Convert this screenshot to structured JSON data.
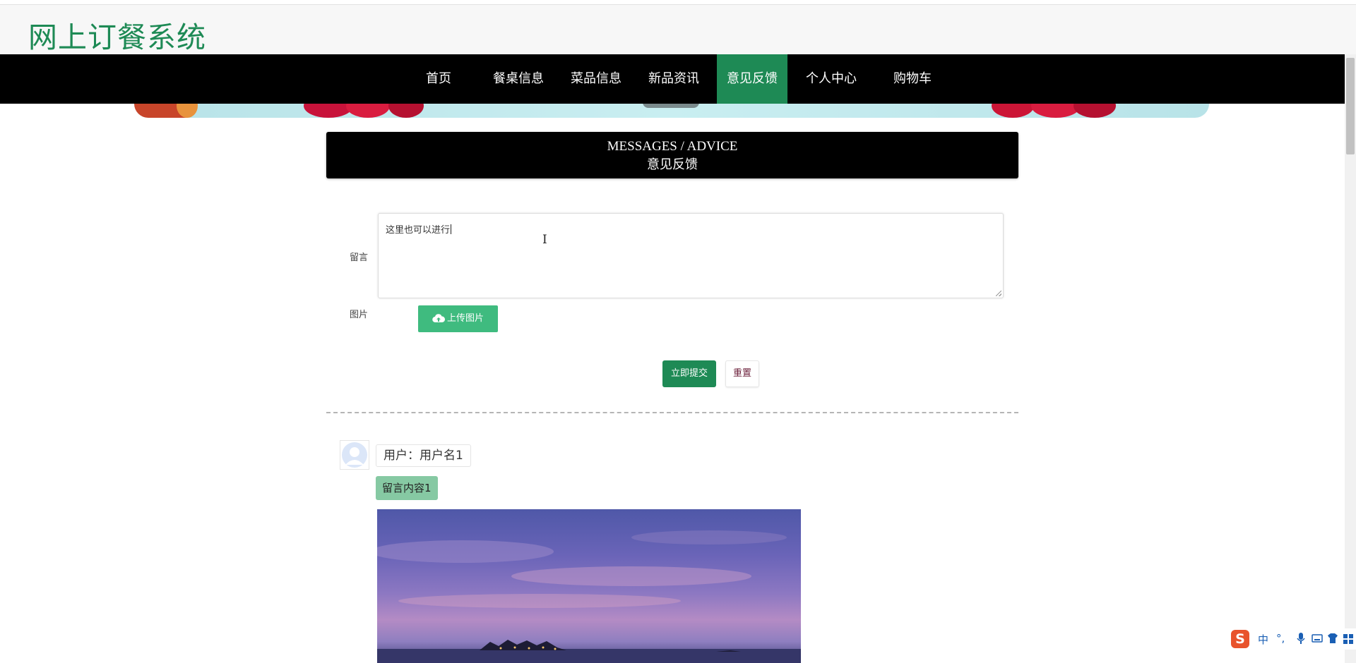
{
  "site": {
    "title": "网上订餐系统"
  },
  "nav": {
    "items": [
      {
        "label": "首页"
      },
      {
        "label": "餐桌信息"
      },
      {
        "label": "菜品信息"
      },
      {
        "label": "新品资讯"
      },
      {
        "label": "意见反馈",
        "active": true
      },
      {
        "label": "个人中心"
      },
      {
        "label": "购物车"
      }
    ]
  },
  "section": {
    "title_en": "MESSAGES / ADVICE",
    "title_cn": "意见反馈"
  },
  "form": {
    "message_label": "留言",
    "message_value": "这里也可以进行",
    "image_label": "图片",
    "upload_label": "上传图片",
    "submit_label": "立即提交",
    "reset_label": "重置"
  },
  "comments": [
    {
      "user": "用户：用户名1",
      "content": "留言内容1"
    }
  ],
  "ime": {
    "lang": "中",
    "punct": "°,"
  },
  "colors": {
    "brand": "#1e8a55",
    "upload": "#3fbb7f",
    "navbar": "#000000",
    "content_tag": "#86c9a3"
  }
}
